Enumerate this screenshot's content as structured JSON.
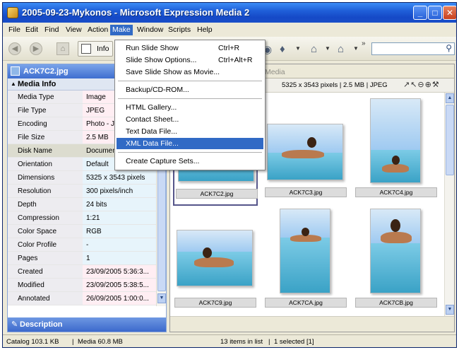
{
  "window": {
    "title": "2005-09-23-Mykonos - Microsoft Expression Media 2"
  },
  "menubar": [
    "File",
    "Edit",
    "Find",
    "View",
    "Action",
    "Make",
    "Window",
    "Scripts",
    "Help"
  ],
  "toolbar": {
    "info_label": "Info"
  },
  "make_menu": {
    "items": [
      {
        "label": "Run Slide Show",
        "shortcut": "Ctrl+R"
      },
      {
        "label": "Slide Show Options...",
        "shortcut": "Ctrl+Alt+R"
      },
      {
        "label": "Save Slide Show as Movie..."
      },
      {
        "label": "Backup/CD-ROM..."
      },
      {
        "label": "HTML Gallery..."
      },
      {
        "label": "Contact Sheet..."
      },
      {
        "label": "Text Data File..."
      },
      {
        "label": "XML Data File...",
        "highlighted": true
      },
      {
        "label": "Create Capture Sets..."
      }
    ]
  },
  "left_panel": {
    "header": "ACK7C2.jpg",
    "section_title": "Media Info",
    "rows": [
      {
        "key": "Media Type",
        "value": "Image"
      },
      {
        "key": "File Type",
        "value": "JPEG"
      },
      {
        "key": "Encoding",
        "value": "Photo - JPEG"
      },
      {
        "key": "File Size",
        "value": "2.5 MB"
      },
      {
        "key": "Disk Name",
        "value": "Documents"
      },
      {
        "key": "Orientation",
        "value": "Default"
      },
      {
        "key": "Dimensions",
        "value": "5325 x 3543 pixels"
      },
      {
        "key": "Resolution",
        "value": "300 pixels/inch"
      },
      {
        "key": "Depth",
        "value": "24 bits"
      },
      {
        "key": "Compression",
        "value": "1:21"
      },
      {
        "key": "Color Space",
        "value": "RGB"
      },
      {
        "key": "Color Profile",
        "value": "-"
      },
      {
        "key": "Pages",
        "value": "1"
      },
      {
        "key": "Created",
        "value": "23/09/2005 5:36:3..."
      },
      {
        "key": "Modified",
        "value": "23/09/2005 5:38:5..."
      },
      {
        "key": "Annotated",
        "value": "26/09/2005 1:00:0..."
      }
    ],
    "description_title": "Description"
  },
  "right_panel": {
    "tab_label": "Media",
    "info_text": "5325 x 3543 pixels | 2.5 MB | JPEG",
    "thumbnails": [
      "ACK7C2.jpg",
      "ACK7C3.jpg",
      "ACK7C4.jpg",
      "ACK7C9.jpg",
      "ACK7CA.jpg",
      "ACK7CB.jpg"
    ]
  },
  "status": {
    "catalog": "Catalog  103.1 KB",
    "media": "Media 60.8 MB",
    "count": "13 items in list",
    "selected": "1 selected [1]"
  }
}
